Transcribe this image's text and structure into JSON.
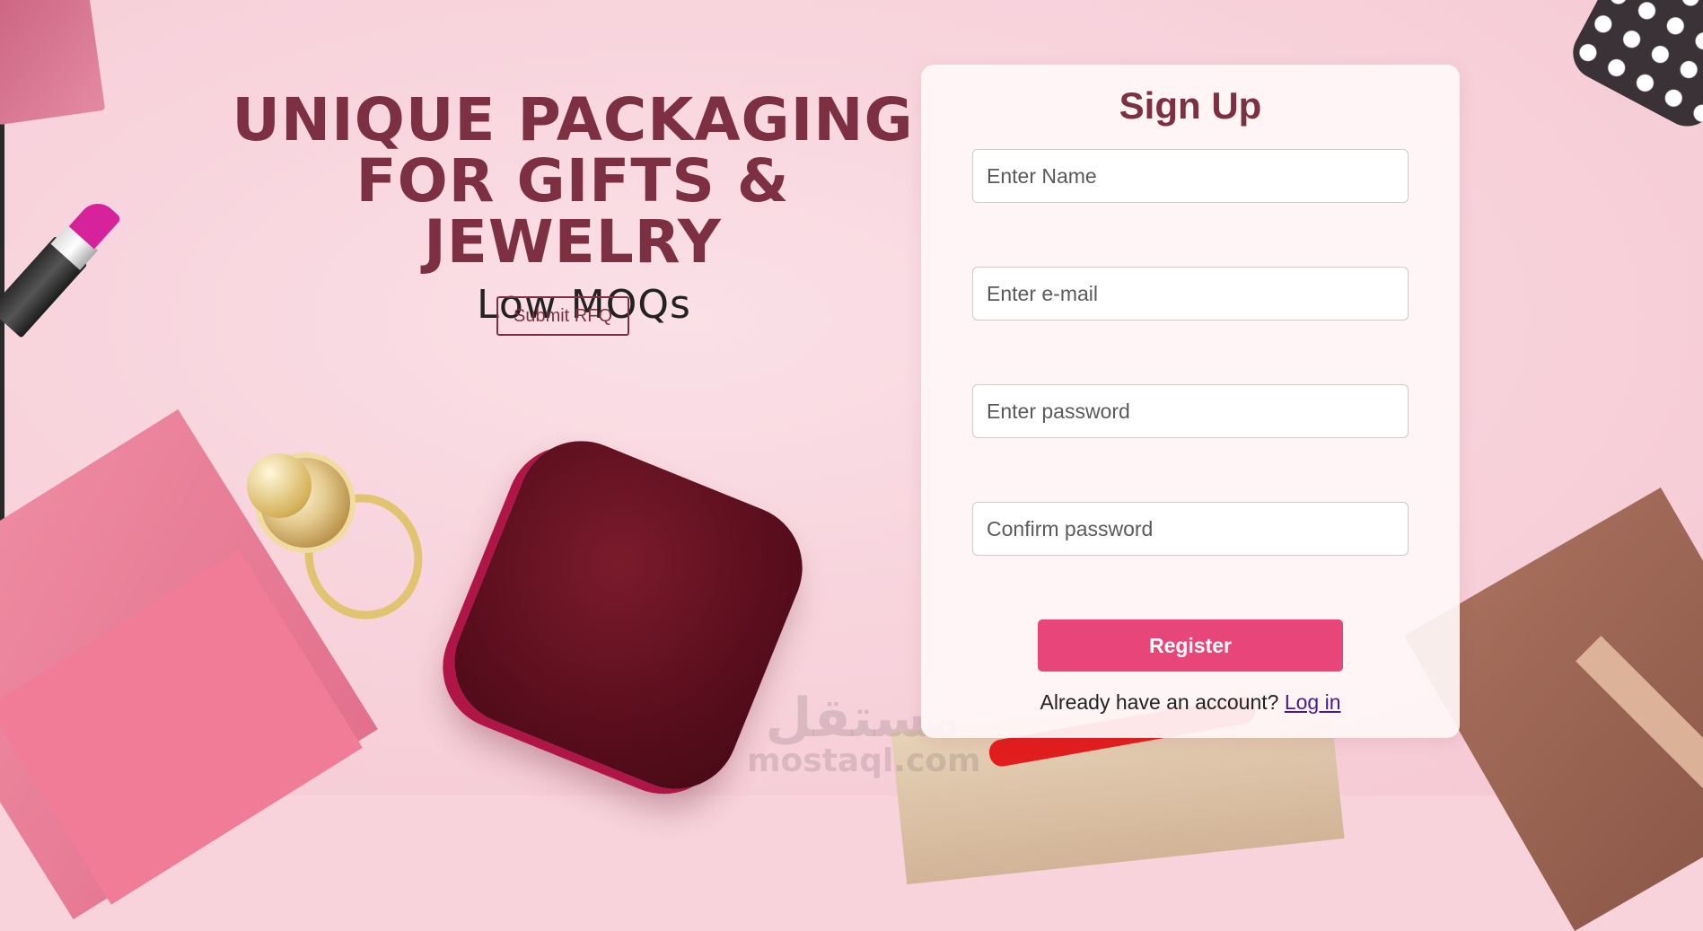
{
  "hero": {
    "title_line1": "UNIQUE PACKAGING",
    "title_line2": "FOR GIFTS & JEWELRY",
    "subtitle": "Low MOQs",
    "rfq_button": "Submit RFQ"
  },
  "signup": {
    "title": "Sign Up",
    "name_placeholder": "Enter Name",
    "email_placeholder": "Enter e-mail",
    "password_placeholder": "Enter password",
    "confirm_placeholder": "Confirm password",
    "register_label": "Register",
    "account_prompt": "Already have an account?",
    "login_link": "Log in"
  },
  "watermark": {
    "arabic": "مستقل",
    "latin": "mostaql.com"
  },
  "colors": {
    "accent": "#e8467a",
    "heading": "#7c3042",
    "background": "#f8d3dc"
  }
}
